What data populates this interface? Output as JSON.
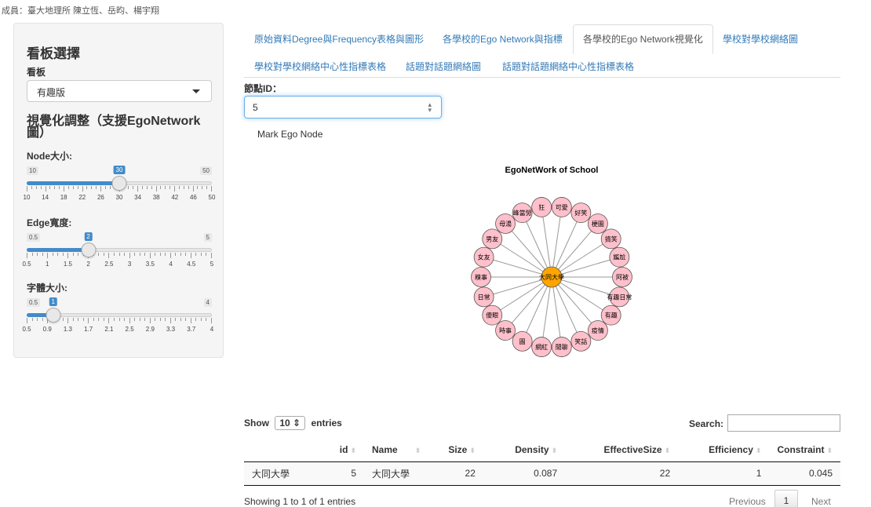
{
  "members": "成員：臺大地理所 陳立恆、岳昀、楊宇翔",
  "sidebar": {
    "title": "看板選擇",
    "board_label": "看板",
    "board_value": "有趣版",
    "viz_title": "視覺化調整（支援EgoNetwork圖）",
    "sliders": [
      {
        "label": "Node大小:",
        "min": "10",
        "max": "50",
        "value": "30",
        "fraction": 0.5,
        "ticks": [
          "10",
          "14",
          "18",
          "22",
          "26",
          "30",
          "34",
          "38",
          "42",
          "46",
          "50"
        ]
      },
      {
        "label": "Edge寬度:",
        "min": "0.5",
        "max": "5",
        "value": "2",
        "fraction": 0.333,
        "ticks": [
          "0.5",
          "1",
          "1.5",
          "2",
          "2.5",
          "3",
          "3.5",
          "4",
          "4.5",
          "5"
        ]
      },
      {
        "label": "字體大小:",
        "min": "0.5",
        "max": "4",
        "value": "1",
        "fraction": 0.143,
        "ticks": [
          "0.5",
          "0.9",
          "1.3",
          "1.7",
          "2.1",
          "2.5",
          "2.9",
          "3.3",
          "3.7",
          "4"
        ]
      }
    ]
  },
  "tabs": [
    {
      "label": "原始資料Degree與Frequency表格與圖形",
      "active": false
    },
    {
      "label": "各學校的Ego Network與指標",
      "active": false
    },
    {
      "label": "各學校的Ego Network視覺化",
      "active": true
    },
    {
      "label": "學校對學校網絡圖",
      "active": false
    },
    {
      "label": "學校對學校網絡中心性指標表格",
      "active": false
    },
    {
      "label": "話題對話題網絡圖",
      "active": false
    },
    {
      "label": "話題對話題網絡中心性指標表格",
      "active": false
    }
  ],
  "node_id": {
    "label": "節點ID：",
    "value": "5"
  },
  "mark_ego": "Mark Ego Node",
  "ego_graph": {
    "title": "EgoNetWork of School",
    "center": "大同大學",
    "neighbors": [
      "可愛",
      "好笑",
      "梗圖",
      "搞笑",
      "尷尬",
      "阿被",
      "有趣日常",
      "有趣",
      "疫情",
      "笑話",
      "閒聊",
      "網紅",
      "圖",
      "時事",
      "傻眼",
      "日常",
      "糗事",
      "女友",
      "男友",
      "母湯",
      "峰當勞",
      "狂"
    ],
    "colors": {
      "center": "#ffa500",
      "neighbor": "#ffc0cb"
    }
  },
  "table": {
    "show_label": "Show",
    "entries_label": "entries",
    "length": "10",
    "search_label": "Search:",
    "columns": [
      "id",
      "Name",
      "Size",
      "Density",
      "EffectiveSize",
      "Efficiency",
      "Constraint"
    ],
    "rows": [
      {
        "rowname": "大同大學",
        "id": "5",
        "name": "大同大學",
        "size": "22",
        "density": "0.087",
        "effective": "22",
        "efficiency": "1",
        "constraint": "0.045"
      }
    ],
    "info": "Showing 1 to 1 of 1 entries",
    "previous": "Previous",
    "page": "1",
    "next": "Next"
  }
}
